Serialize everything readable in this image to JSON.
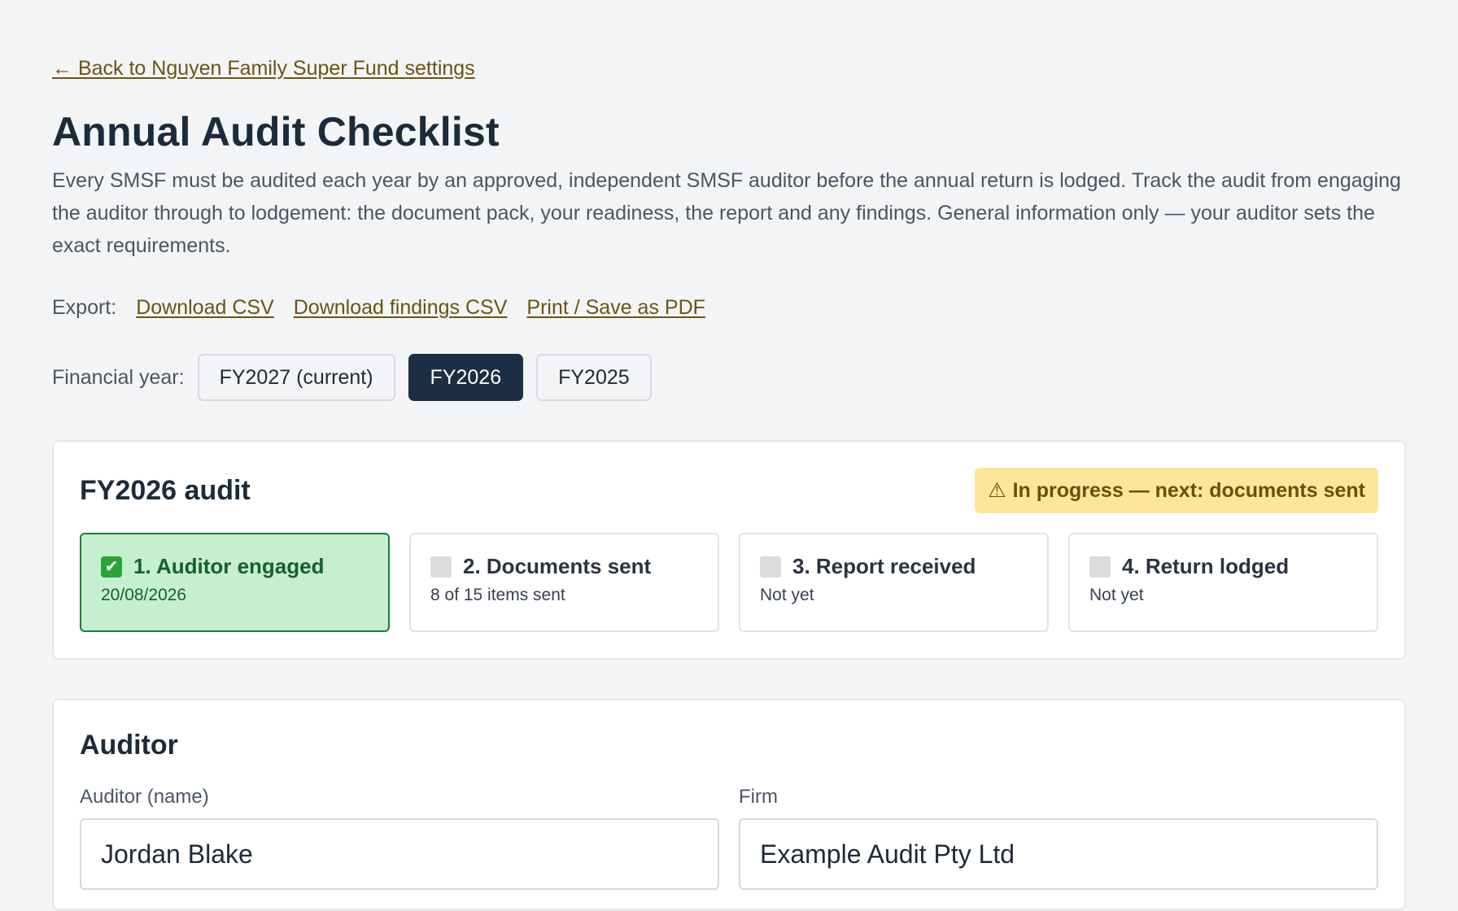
{
  "back_link": "← Back to Nguyen Family Super Fund settings",
  "page_title": "Annual Audit Checklist",
  "intro": "Every SMSF must be audited each year by an approved, independent SMSF auditor before the annual return is lodged. Track the audit from engaging the auditor through to lodgement: the document pack, your readiness, the report and any findings. General information only — your auditor sets the exact requirements.",
  "export": {
    "label": "Export:",
    "links": [
      "Download CSV",
      "Download findings CSV",
      "Print / Save as PDF"
    ]
  },
  "financial_year": {
    "label": "Financial year:",
    "options": [
      "FY2027 (current)",
      "FY2026",
      "FY2025"
    ],
    "selected": "FY2026"
  },
  "audit_card": {
    "title": "FY2026 audit",
    "status": "In progress — next: documents sent",
    "status_icon": "⚠",
    "steps": [
      {
        "label": "1. Auditor engaged",
        "sub": "20/08/2026",
        "done": true
      },
      {
        "label": "2. Documents sent",
        "sub": "8 of 15 items sent",
        "done": false
      },
      {
        "label": "3. Report received",
        "sub": "Not yet",
        "done": false
      },
      {
        "label": "4. Return lodged",
        "sub": "Not yet",
        "done": false
      }
    ]
  },
  "auditor_card": {
    "title": "Auditor",
    "name_label": "Auditor (name)",
    "name_value": "Jordan Blake",
    "firm_label": "Firm",
    "firm_value": "Example Audit Pty Ltd"
  },
  "colors": {
    "accent_link": "#6b5410",
    "active_year": "#1c2f42",
    "status_badge_bg": "#fbe69a",
    "step_done_bg": "#c6efcf"
  }
}
